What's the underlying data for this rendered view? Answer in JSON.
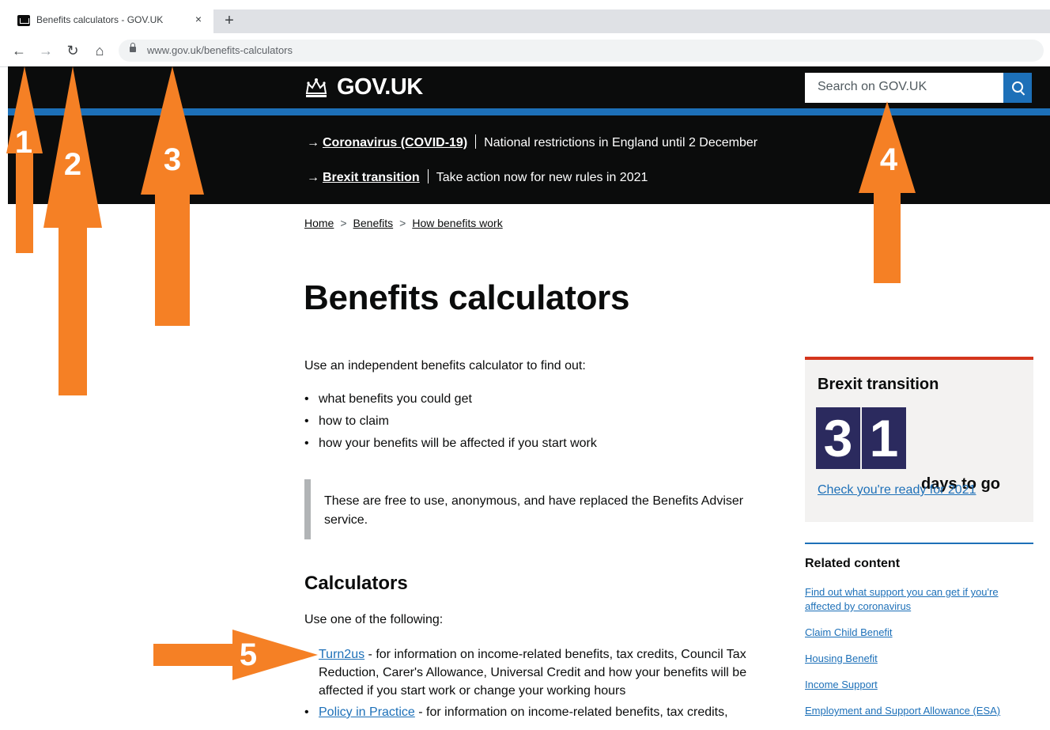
{
  "browser": {
    "tab_title": "Benefits calculators - GOV.UK",
    "tab_close": "×",
    "new_tab": "+",
    "back": "←",
    "forward": "→",
    "reload": "↻",
    "home": "⌂",
    "url": "www.gov.uk/benefits-calculators"
  },
  "header": {
    "logo_text": "GOV.UK",
    "search_placeholder": "Search on GOV.UK"
  },
  "notices": [
    {
      "arrow": "→",
      "link": "Coronavirus (COVID-19)",
      "text": "National restrictions in England until 2 December"
    },
    {
      "arrow": "→",
      "link": "Brexit transition",
      "text": "Take action now for new rules in 2021"
    }
  ],
  "breadcrumb": {
    "items": [
      "Home",
      "Benefits",
      "How benefits work"
    ],
    "separator": ">"
  },
  "main": {
    "title": "Benefits calculators",
    "intro": "Use an independent benefits calculator to find out:",
    "list": [
      "what benefits you could get",
      "how to claim",
      "how your benefits will be affected if you start work"
    ],
    "inset": "These are free to use, anonymous, and have replaced the Benefits Adviser service.",
    "calculators_heading": "Calculators",
    "calculators_intro": "Use one of the following:",
    "calculators": [
      {
        "link": "Turn2us",
        "text": " - for information on income-related benefits, tax credits, Council Tax Reduction, Carer's Allowance, Universal Credit and how your benefits will be affected if you start work or change your working hours"
      },
      {
        "link": "Policy in Practice",
        "text": " - for information on income-related benefits, tax credits,"
      }
    ]
  },
  "sidebar": {
    "brexit": {
      "title": "Brexit transition",
      "digits": [
        "3",
        "1"
      ],
      "days_label": "days to go",
      "link": "Check you're ready for 2021"
    },
    "related": {
      "title": "Related content",
      "links": [
        "Find out what support you can get if you're affected by coronavirus",
        "Claim Child Benefit",
        "Housing Benefit",
        "Income Support",
        "Employment and Support Allowance (ESA)"
      ]
    }
  },
  "annotations": {
    "color": "#f58025",
    "labels": [
      "1",
      "2",
      "3",
      "4",
      "5"
    ]
  }
}
